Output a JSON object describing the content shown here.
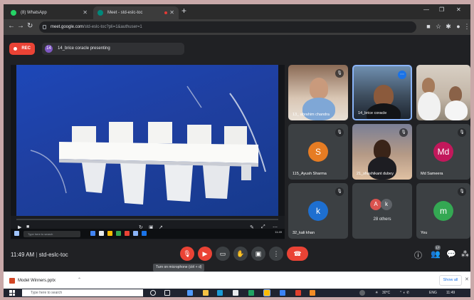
{
  "browser": {
    "tabs": [
      {
        "label": "(8) WhatsApp",
        "active": false
      },
      {
        "label": "Meet - std-eslc-toc",
        "active": true
      }
    ],
    "url_host": "meet.google.com",
    "url_path": "/std-eslc-toc?pli=1&authuser=1"
  },
  "meet": {
    "rec_label": "REC",
    "presenter_initial": "14",
    "presenter_text": "14_brice coracle presenting",
    "clock": "11:49 AM",
    "separator": "|",
    "meeting_code": "std-eslc-toc",
    "tooltip": "Turn on microphone (ctrl + d)",
    "participants_count": "17",
    "tiles": [
      {
        "name": "13_ abrahim chandra",
        "type": "camera"
      },
      {
        "name": "14_brice coracle",
        "type": "camera",
        "speaking": true
      },
      {
        "name": "",
        "type": "camera"
      },
      {
        "name": "115_Ayush Sharma",
        "type": "avatar",
        "initial": "S",
        "color": "#e67c23"
      },
      {
        "name": "21_shashikant dubey",
        "type": "camera"
      },
      {
        "name": "Md Sameera",
        "type": "avatar",
        "initial": "Md",
        "color": "#c2185b"
      },
      {
        "name": "32_kali khan",
        "type": "avatar",
        "initial": "k",
        "color": "#1e6fd0"
      },
      {
        "name": "28 others",
        "type": "others"
      },
      {
        "name": "You",
        "type": "avatar",
        "initial": "m",
        "color": "#34a853"
      }
    ],
    "others_initials": [
      "A",
      "k"
    ]
  },
  "presentation": {
    "video_progress": 0.0,
    "taskbar_search": "Type here to search",
    "taskbar_time": "11:49"
  },
  "download_shelf": {
    "file": "Model Winners.pptx",
    "show_all": "Show all"
  },
  "taskbar": {
    "search_placeholder": "Type here to search",
    "weather": "30°C",
    "lang": "ENG",
    "time": "11:49"
  },
  "colors": {
    "meet_bg": "#202124",
    "red": "#ea4335",
    "tile_bg": "#3c4043",
    "speaking": "#8ab4f8"
  }
}
